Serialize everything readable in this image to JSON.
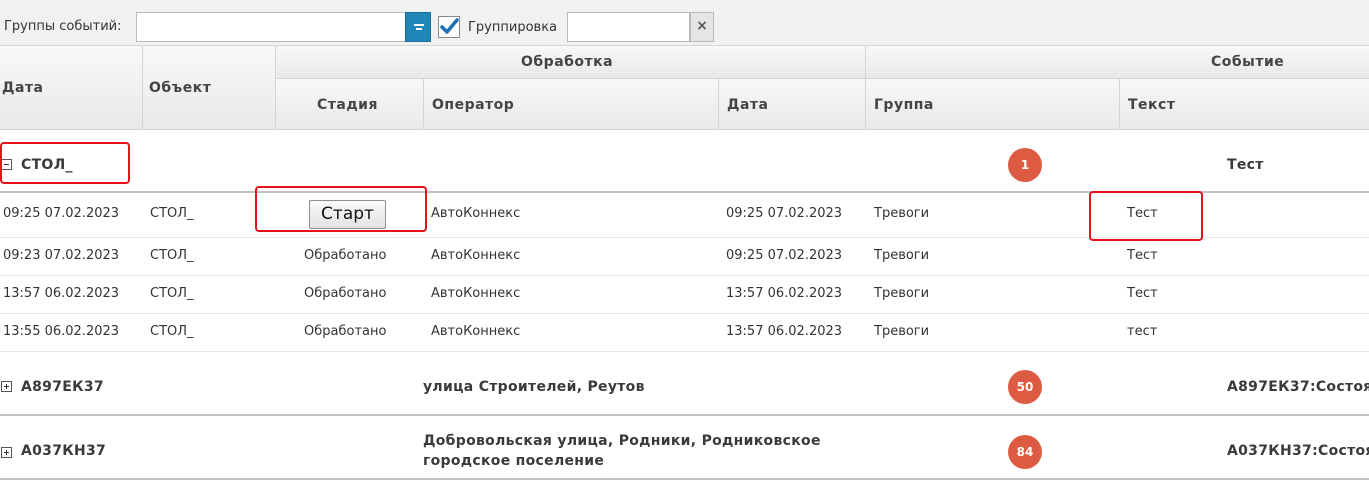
{
  "toolbar": {
    "groups_label": "Группы событий:",
    "groups_value": "",
    "grouping_label": "Группировка",
    "grouping_checked": true,
    "filter_value": "",
    "clear_label": "×"
  },
  "header": {
    "date": "Дата",
    "object": "Объект",
    "processing": "Обработка",
    "stage": "Стадия",
    "operator": "Оператор",
    "proc_date": "Дата",
    "event": "Событие",
    "group": "Группа",
    "text": "Текст"
  },
  "groups": [
    {
      "name": "СТОЛ_",
      "address": "",
      "count": "1",
      "event_text": "Тест",
      "expanded": true,
      "rows": [
        {
          "date": "09:25 07.02.2023",
          "object": "СТОЛ_",
          "stage": "Старт",
          "stage_is_button": true,
          "operator": "АвтоКоннекс",
          "proc_date": "09:25 07.02.2023",
          "group": "Тревоги",
          "text": "Тест"
        },
        {
          "date": "09:23 07.02.2023",
          "object": "СТОЛ_",
          "stage": "Обработано",
          "stage_is_button": false,
          "operator": "АвтоКоннекс",
          "proc_date": "09:25 07.02.2023",
          "group": "Тревоги",
          "text": "Тест"
        },
        {
          "date": "13:57 06.02.2023",
          "object": "СТОЛ_",
          "stage": "Обработано",
          "stage_is_button": false,
          "operator": "АвтоКоннекс",
          "proc_date": "13:57 06.02.2023",
          "group": "Тревоги",
          "text": "Тест"
        },
        {
          "date": "13:55 06.02.2023",
          "object": "СТОЛ_",
          "stage": "Обработано",
          "stage_is_button": false,
          "operator": "АвтоКоннекс",
          "proc_date": "13:57 06.02.2023",
          "group": "Тревоги",
          "text": "тест"
        }
      ]
    },
    {
      "name": "А897ЕК37",
      "address": "улица Строителей, Реутов",
      "count": "50",
      "event_text": "А897ЕК37:Состоя",
      "expanded": false
    },
    {
      "name": "А037КН37",
      "address_line1": "Добровольская улица, Родники, Родниковское",
      "address_line2": "городское поселение",
      "count": "84",
      "event_text": "А037КН37:Состоя",
      "expanded": false
    }
  ],
  "colors": {
    "accent": "#1f86b7",
    "badge": "#dd5a43",
    "highlight": "#e8121a"
  }
}
